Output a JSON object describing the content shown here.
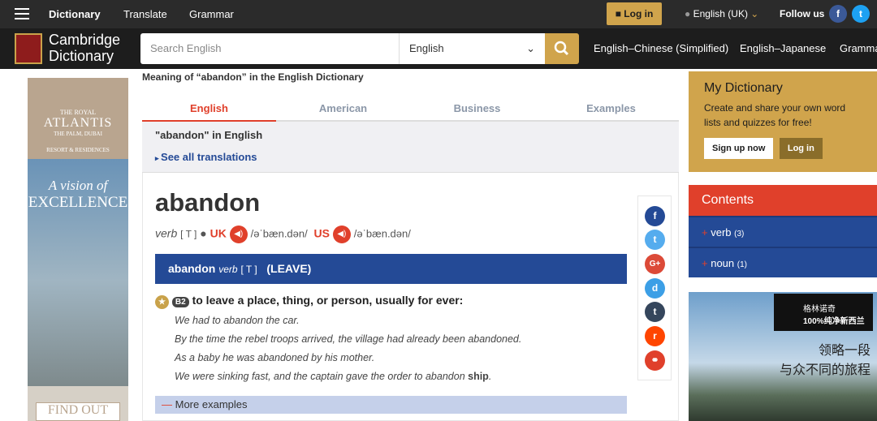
{
  "topbar": {
    "nav": [
      "Dictionary",
      "Translate",
      "Grammar"
    ],
    "login": "Log in",
    "language": "English (UK)",
    "follow": "Follow us"
  },
  "header": {
    "logo": [
      "Cambridge",
      "Dictionary"
    ],
    "search_placeholder": "Search English",
    "select": "English",
    "nav": [
      "English–Chinese (Simplified)",
      "English–Japanese",
      "Gramma"
    ]
  },
  "ad_left": {
    "brand": "ATLANTIS",
    "sub": "THE ROYAL",
    "place": "THE PALM, DUBAI",
    "line": "RESORT & RESIDENCES",
    "tag1": "A vision of",
    "tag2": "EXCELLENCE",
    "cta": "FIND OUT"
  },
  "main": {
    "meaning": "Meaning of “abandon” in the English Dictionary",
    "tabs": [
      "English",
      "American",
      "Business",
      "Examples"
    ],
    "in_english": "\"abandon\" in English",
    "see_all": "See all translations",
    "headword": "abandon",
    "pos": "verb",
    "gram": "[ T ]",
    "uk": "UK",
    "us": "US",
    "ipa_uk": "/əˈbæn.dən/",
    "ipa_us": "/əˈbæn.dən/",
    "sense": {
      "word": "abandon",
      "pos": "verb",
      "gram": "[ T ]",
      "guide": "(LEAVE)"
    },
    "level": "B2",
    "definition": "to leave a place, thing, or person, usually for ever:",
    "examples": [
      "We had to abandon the car.",
      "By the time the rebel troops arrived, the village had already been abandoned.",
      "As a baby he was abandoned by his mother.",
      "We were sinking fast, and the captain gave the order to abandon "
    ],
    "example_bold": "ship",
    "example_end": ".",
    "more": "More examples"
  },
  "share": [
    "f",
    "t",
    "G+",
    "d",
    "t",
    "r",
    "⚭"
  ],
  "sidebar": {
    "title": "My Dictionary",
    "text": "Create and share your own word lists and quizzes for free!",
    "signup": "Sign up now",
    "login": "Log in",
    "contents": "Contents",
    "items": [
      {
        "label": "verb",
        "count": "(3)"
      },
      {
        "label": "noun",
        "count": "(1)"
      }
    ]
  },
  "ad_right": {
    "brand": "格林诺奇",
    "line1": "100%纯净新西兰",
    "line2": "领略一段",
    "line3": "与众不同的旅程"
  }
}
